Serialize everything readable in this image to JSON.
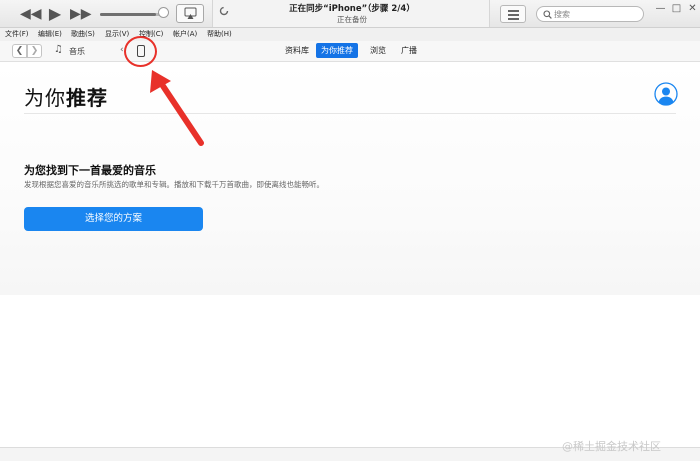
{
  "player": {
    "prev_icon": "rewind-icon",
    "play_icon": "play-icon",
    "next_icon": "fast-forward-icon",
    "volume_level": 0.88,
    "airplay_icon": "airplay-icon"
  },
  "status": {
    "title": "正在同步“iPhone”（步骤 2/4）",
    "subtitle": "正在备份",
    "sync_icon": "sync-spinner-icon"
  },
  "toolbar": {
    "list_icon": "list-view-icon",
    "search_placeholder": "搜索"
  },
  "window_controls": [
    "minimize-icon",
    "maximize-icon",
    "close-icon"
  ],
  "menu": [
    {
      "label": "文件(F)"
    },
    {
      "label": "编辑(E)"
    },
    {
      "label": "歌曲(S)"
    },
    {
      "label": "显示(V)"
    },
    {
      "label": "控制(C)"
    },
    {
      "label": "帐户(A)"
    },
    {
      "label": "帮助(H)"
    }
  ],
  "nav": {
    "back_icon": "chevron-left-icon",
    "forward_icon": "chevron-right-icon",
    "media_label": "音乐",
    "media_icon": "music-note-icon",
    "device_icon": "iphone-icon",
    "tabs": [
      {
        "label": "资料库",
        "selected": false
      },
      {
        "label": "为你推荐",
        "selected": true
      },
      {
        "label": "浏览",
        "selected": false
      },
      {
        "label": "广播",
        "selected": false
      }
    ]
  },
  "main": {
    "title_prefix": "为你",
    "title_emph": "推荐",
    "avatar_icon": "user-avatar-icon",
    "heading": "为您找到下一首最爱的音乐",
    "description": "发现根据您喜爱的音乐所挑选的歌单和专辑。播放和下载千万首歌曲，即使离线也能畅听。",
    "cta_label": "选择您的方案"
  },
  "watermark": "@稀土掘金技术社区",
  "colors": {
    "accent": "#1473e6",
    "cta": "#1a86f0",
    "annotation": "#e8312a"
  }
}
